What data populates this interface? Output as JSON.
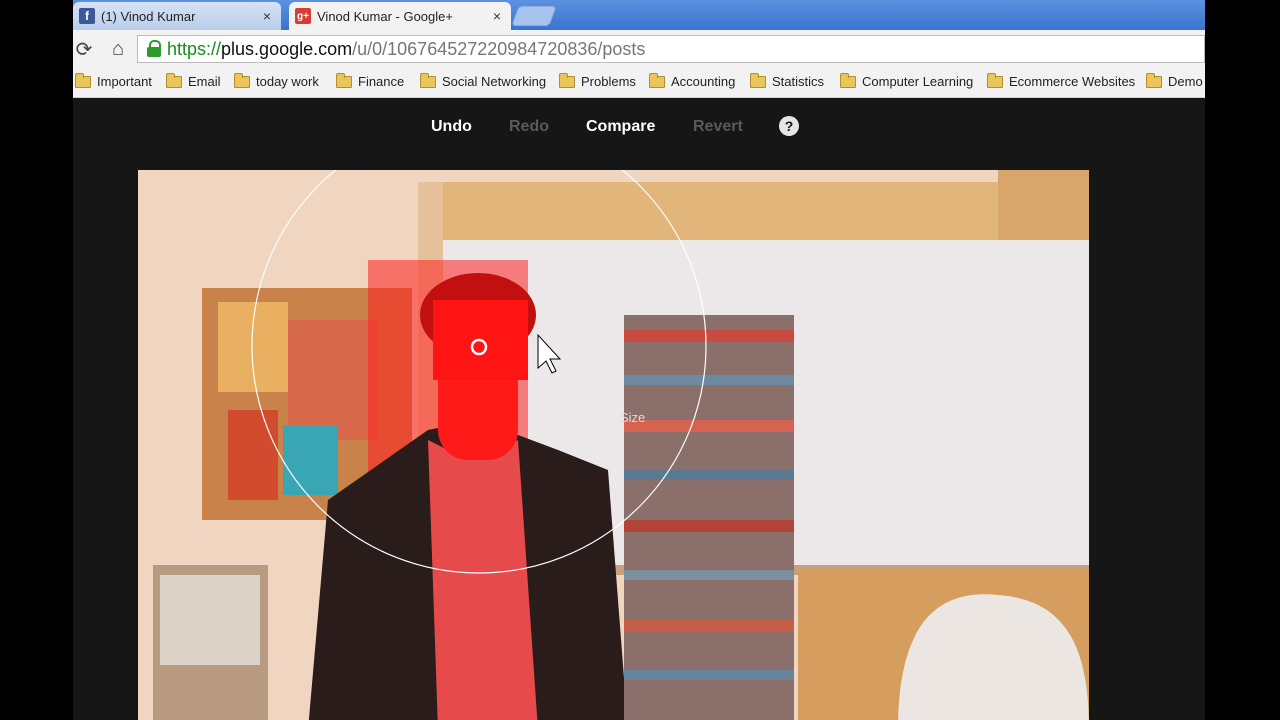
{
  "tabs": [
    {
      "title": "(1) Vinod Kumar",
      "close": "×",
      "favicon": "f",
      "favicon_color": "#3b5998"
    },
    {
      "title": "Vinod Kumar - Google+",
      "close": "×",
      "favicon": "g+",
      "favicon_color": "#d73d32"
    }
  ],
  "toolbar": {
    "reload_icon": "⟳",
    "home_icon": "⌂",
    "url_scheme": "https://",
    "url_host": "plus.google.com",
    "url_path": "/u/0/106764527220984720836/posts"
  },
  "bookmarks": [
    "Important",
    "Email",
    "today work",
    "Finance",
    "Social Networking",
    "Problems",
    "Accounting",
    "Statistics",
    "Computer Learning",
    "Ecommerce Websites",
    "Demo"
  ],
  "editor": {
    "undo": "Undo",
    "redo": "Redo",
    "compare": "Compare",
    "revert": "Revert",
    "help_icon": "?",
    "brush_size_label": "Size"
  },
  "colors": {
    "tab_strip": "#3a74cf",
    "editor_bg": "#161616",
    "selection_overlay": "#ff0000",
    "secure_green": "#1b8a1b"
  }
}
